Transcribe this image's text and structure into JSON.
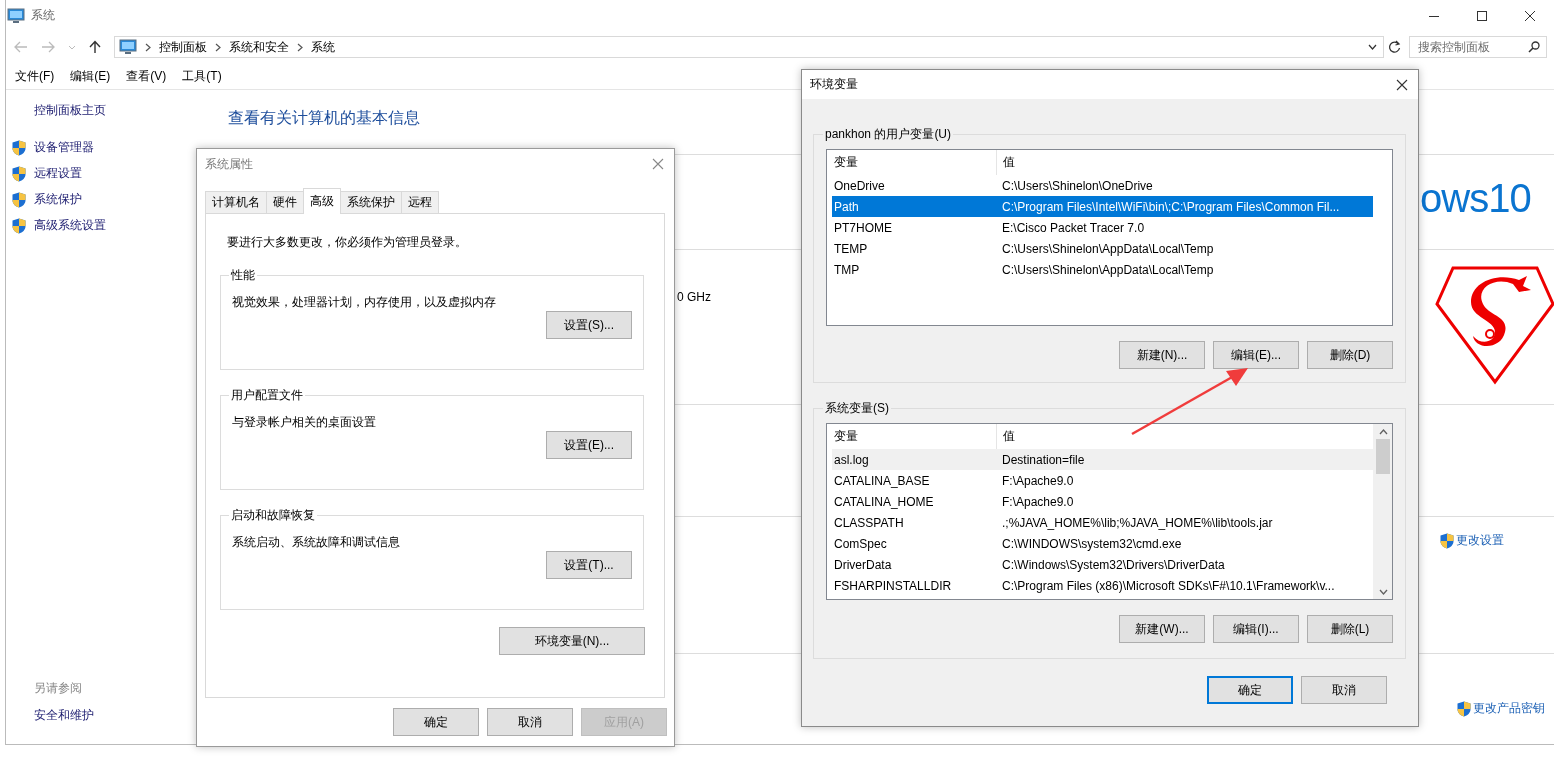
{
  "window": {
    "title": "系统"
  },
  "address_bar": {
    "crumbs": [
      "控制面板",
      "系统和安全",
      "系统"
    ]
  },
  "search": {
    "placeholder": "搜索控制面板"
  },
  "menu": [
    "文件(F)",
    "编辑(E)",
    "查看(V)",
    "工具(T)"
  ],
  "sidebar": {
    "home": "控制面板主页",
    "items": [
      "设备管理器",
      "远程设置",
      "系统保护",
      "高级系统设置"
    ],
    "see_also_title": "另请参阅",
    "see_also": [
      "安全和维护"
    ]
  },
  "main": {
    "heading": "查看有关计算机的基本信息",
    "processor_fragment": "0 GHz",
    "edition_fragment": "ows10",
    "links": [
      "更改设置",
      "更改产品密钥"
    ]
  },
  "system_properties": {
    "title": "系统属性",
    "tabs": [
      {
        "label": "计算机名",
        "selected": false
      },
      {
        "label": "硬件",
        "selected": false
      },
      {
        "label": "高级",
        "selected": true
      },
      {
        "label": "系统保护",
        "selected": false
      },
      {
        "label": "远程",
        "selected": false
      }
    ],
    "notice": "要进行大多数更改，你必须作为管理员登录。",
    "groups": [
      {
        "title": "性能",
        "description": "视觉效果，处理器计划，内存使用，以及虚拟内存",
        "button": "设置(S)..."
      },
      {
        "title": "用户配置文件",
        "description": "与登录帐户相关的桌面设置",
        "button": "设置(E)..."
      },
      {
        "title": "启动和故障恢复",
        "description": "系统启动、系统故障和调试信息",
        "button": "设置(T)..."
      }
    ],
    "env_button": "环境变量(N)...",
    "buttons": [
      {
        "label": "确定",
        "disabled": false
      },
      {
        "label": "取消",
        "disabled": false
      },
      {
        "label": "应用(A)",
        "disabled": true
      }
    ]
  },
  "environment_variables": {
    "title": "环境变量",
    "groups": [
      {
        "title": "pankhon 的用户变量(U)",
        "columns": [
          "变量",
          "值"
        ],
        "focused": true,
        "rows": [
          {
            "name": "OneDrive",
            "value": "C:\\Users\\Shinelon\\OneDrive",
            "selected": false
          },
          {
            "name": "Path",
            "value": "C:\\Program Files\\Intel\\WiFi\\bin\\;C:\\Program Files\\Common Fil...",
            "selected": true
          },
          {
            "name": "PT7HOME",
            "value": "E:\\Cisco Packet Tracer 7.0",
            "selected": false
          },
          {
            "name": "TEMP",
            "value": "C:\\Users\\Shinelon\\AppData\\Local\\Temp",
            "selected": false
          },
          {
            "name": "TMP",
            "value": "C:\\Users\\Shinelon\\AppData\\Local\\Temp",
            "selected": false
          }
        ],
        "buttons": [
          "新建(N)...",
          "编辑(E)...",
          "删除(D)"
        ]
      },
      {
        "title": "系统变量(S)",
        "columns": [
          "变量",
          "值"
        ],
        "focused": false,
        "rows": [
          {
            "name": "asl.log",
            "value": "Destination=file",
            "selected": true
          },
          {
            "name": "CATALINA_BASE",
            "value": "F:\\Apache9.0",
            "selected": false
          },
          {
            "name": "CATALINA_HOME",
            "value": "F:\\Apache9.0",
            "selected": false
          },
          {
            "name": "CLASSPATH",
            "value": ".;%JAVA_HOME%\\lib;%JAVA_HOME%\\lib\\tools.jar",
            "selected": false
          },
          {
            "name": "ComSpec",
            "value": "C:\\WINDOWS\\system32\\cmd.exe",
            "selected": false
          },
          {
            "name": "DriverData",
            "value": "C:\\Windows\\System32\\Drivers\\DriverData",
            "selected": false
          },
          {
            "name": "FSHARPINSTALLDIR",
            "value": "C:\\Program Files (x86)\\Microsoft SDKs\\F#\\10.1\\Framework\\v...",
            "selected": false
          }
        ],
        "buttons": [
          "新建(W)...",
          "编辑(I)...",
          "删除(L)"
        ]
      }
    ],
    "buttons": [
      {
        "label": "确定",
        "default": true
      },
      {
        "label": "取消",
        "default": false
      }
    ]
  }
}
